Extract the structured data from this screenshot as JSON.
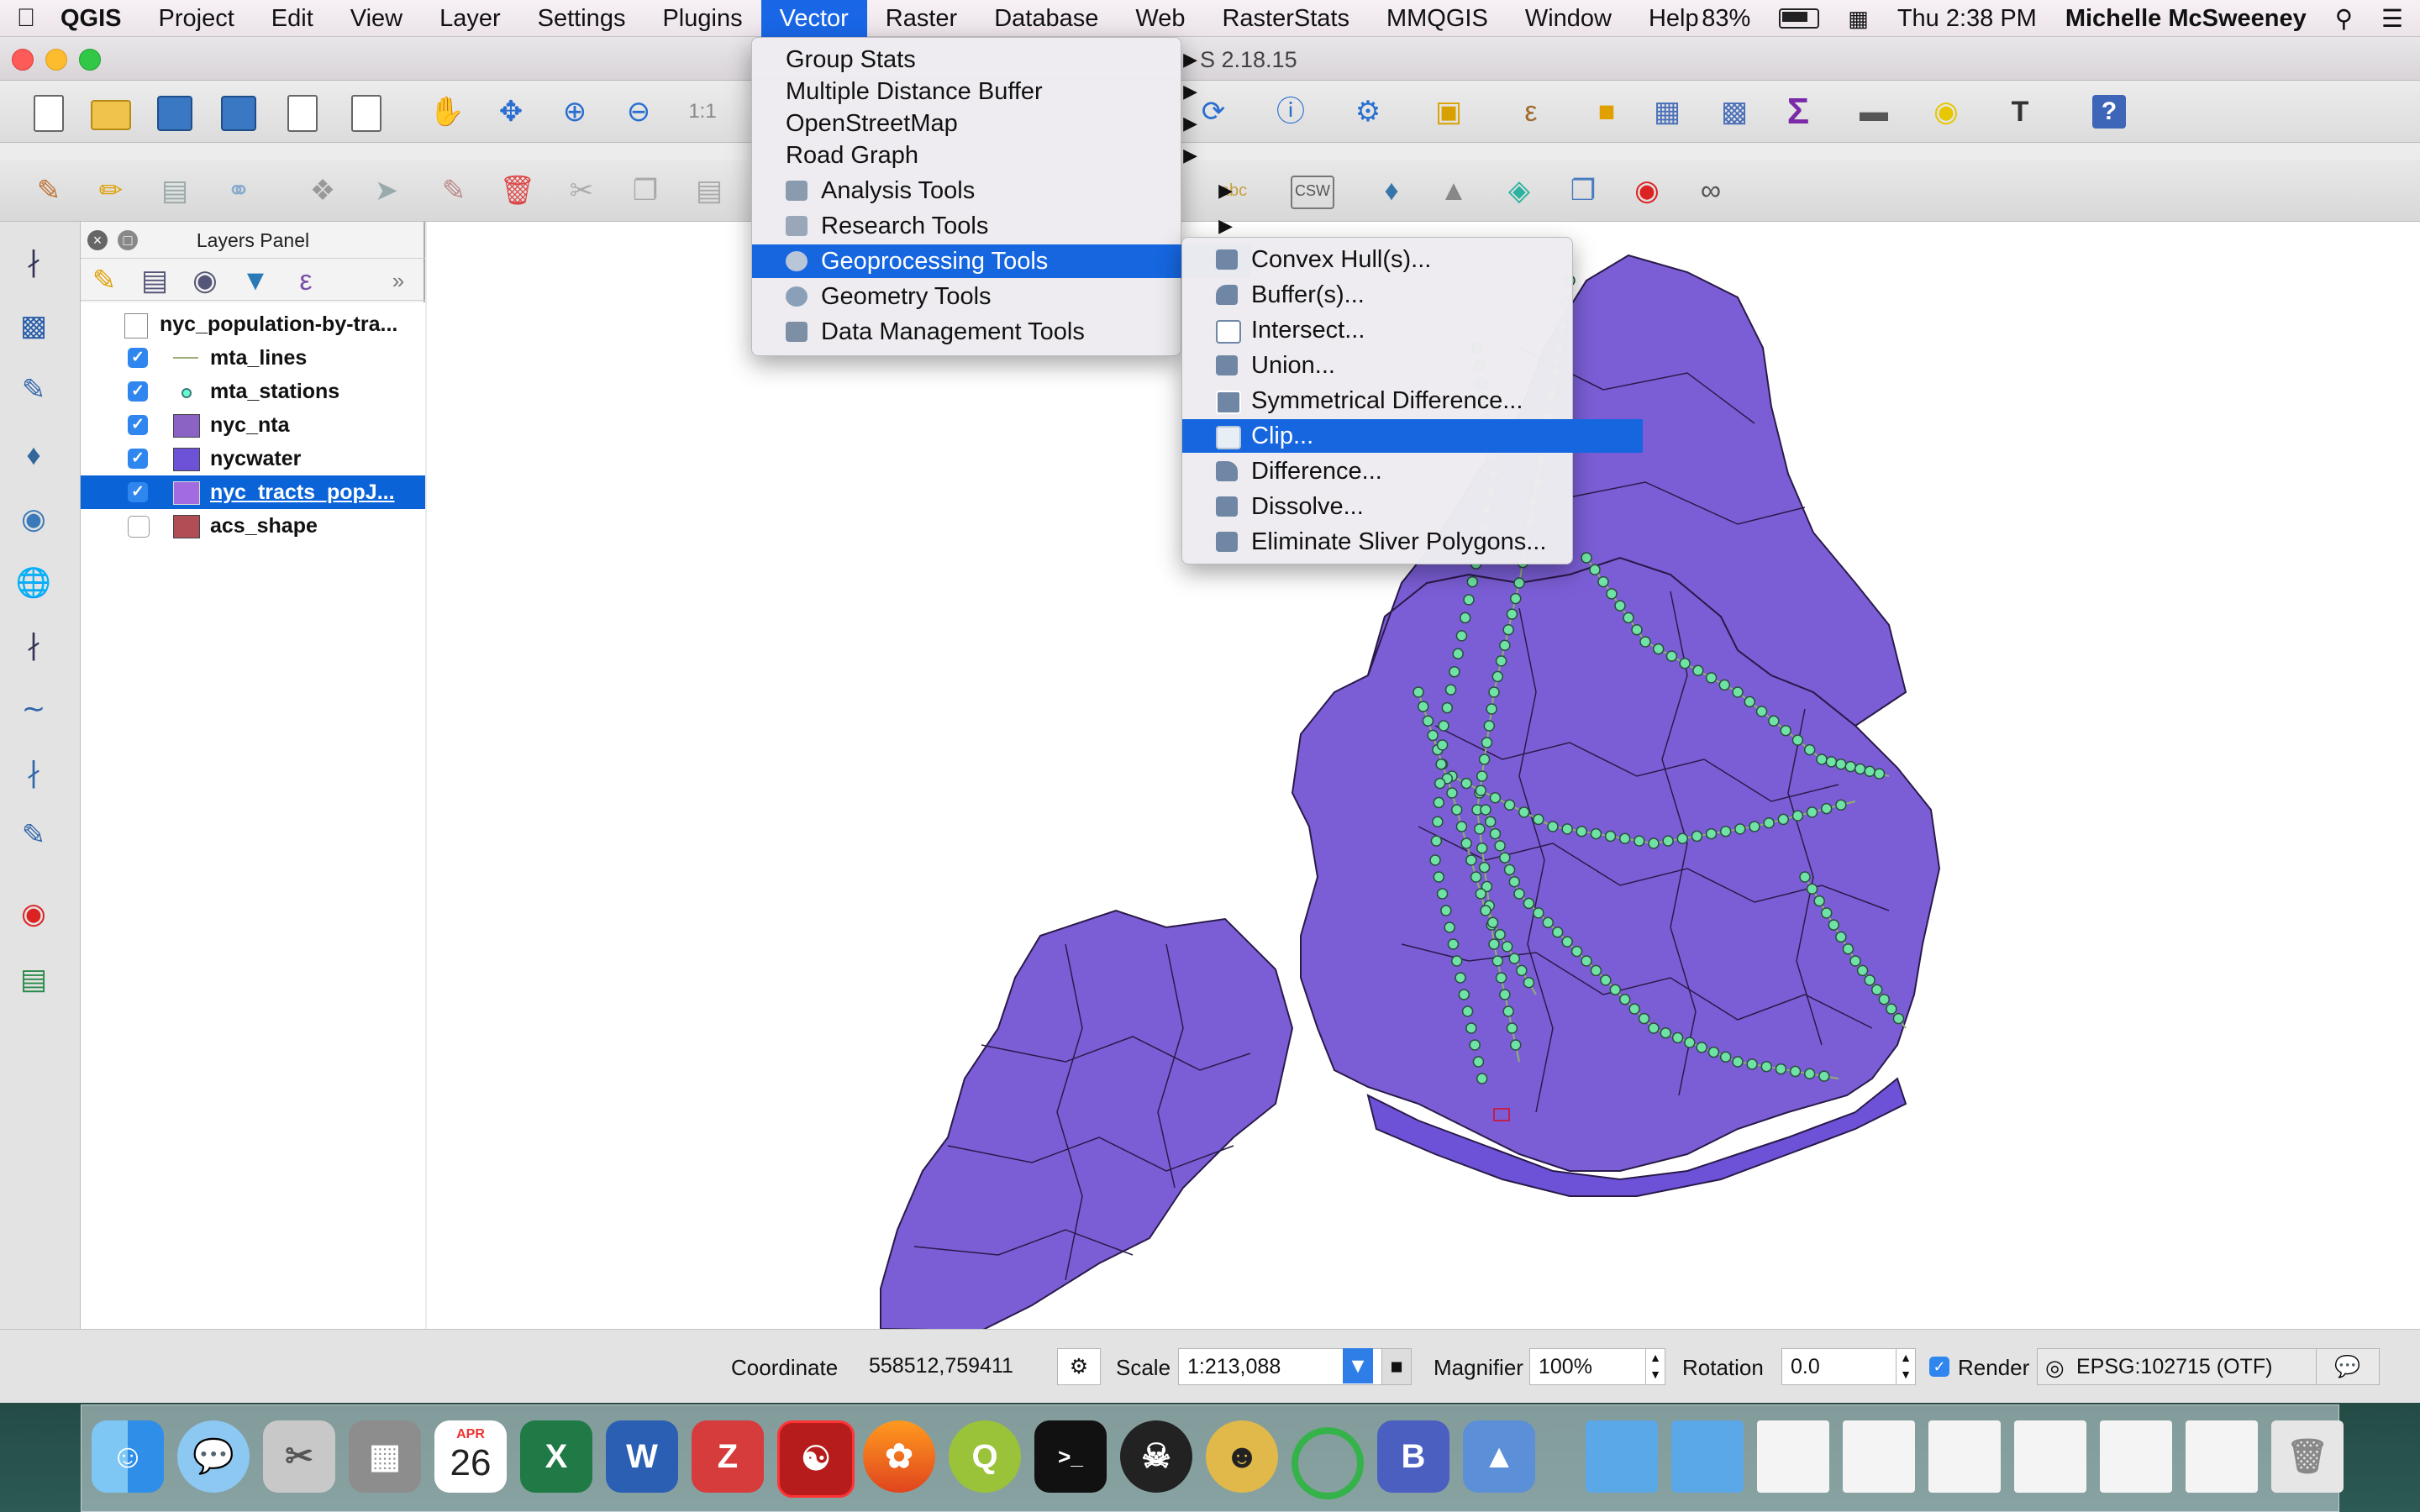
{
  "menubar": {
    "app": "QGIS",
    "items": [
      "Project",
      "Edit",
      "View",
      "Layer",
      "Settings",
      "Plugins",
      "Vector",
      "Raster",
      "Database",
      "Web",
      "RasterStats",
      "MMQGIS",
      "Window",
      "Help"
    ],
    "active": "Vector",
    "battery": "83%",
    "clock": "Thu 2:38 PM",
    "user": "Michelle McSweeney"
  },
  "window": {
    "title_fragment": "S 2.18.15"
  },
  "vector_menu": {
    "items": [
      {
        "label": "Group Stats",
        "submenu": true
      },
      {
        "label": "Multiple Distance Buffer",
        "submenu": true
      },
      {
        "label": "OpenStreetMap",
        "submenu": true
      },
      {
        "label": "Road Graph",
        "submenu": true
      },
      {
        "label": "Analysis Tools",
        "submenu": true
      },
      {
        "label": "Research Tools",
        "submenu": true
      },
      {
        "label": "Geoprocessing Tools",
        "submenu": true
      },
      {
        "label": "Geometry Tools",
        "submenu": true
      },
      {
        "label": "Data Management Tools",
        "submenu": true
      }
    ],
    "highlighted": "Geoprocessing Tools"
  },
  "geo_submenu": {
    "items": [
      "Convex Hull(s)...",
      "Buffer(s)...",
      "Intersect...",
      "Union...",
      "Symmetrical Difference...",
      "Clip...",
      "Difference...",
      "Dissolve...",
      "Eliminate Sliver Polygons..."
    ],
    "highlighted": "Clip..."
  },
  "layers_panel": {
    "title": "Layers Panel",
    "layers": [
      {
        "name": "nyc_population-by-tra...",
        "checked": null,
        "type": "table"
      },
      {
        "name": "mta_lines",
        "checked": true,
        "type": "line"
      },
      {
        "name": "mta_stations",
        "checked": true,
        "type": "point"
      },
      {
        "name": "nyc_nta",
        "checked": true,
        "type": "polygon",
        "color": "#8a63c4"
      },
      {
        "name": "nycwater",
        "checked": true,
        "type": "polygon",
        "color": "#6d52d8"
      },
      {
        "name": "nyc_tracts_popJ...",
        "checked": true,
        "type": "polygon",
        "color": "#a36be0",
        "selected": true
      },
      {
        "name": "acs_shape",
        "checked": false,
        "type": "polygon",
        "color": "#b04d55"
      }
    ]
  },
  "statusbar": {
    "coordinate_label": "Coordinate",
    "coordinate": "558512,759411",
    "scale_label": "Scale",
    "scale": "1:213,088",
    "magnifier_label": "Magnifier",
    "magnifier": "100%",
    "rotation_label": "Rotation",
    "rotation": "0.0",
    "render_label": "Render",
    "render_checked": true,
    "crs": "EPSG:102715 (OTF)"
  },
  "dock": {
    "calendar_month": "APR",
    "calendar_day": "26",
    "apps": [
      "finder",
      "messages",
      "scissors",
      "calculator",
      "calendar",
      "excel",
      "word",
      "zotero",
      "acrobat",
      "firefox",
      "qgis",
      "terminal",
      "skull",
      "photo",
      "green-circle",
      "bbedit",
      "keynote",
      "folder",
      "folder",
      "doc",
      "doc",
      "doc",
      "doc",
      "doc",
      "doc",
      "doc",
      "trash"
    ]
  },
  "colors": {
    "menu_highlight": "#1666e0",
    "map_fill": "#7b5ed6",
    "map_outline": "#2a1a4a",
    "station_point": "#6fe3a5"
  }
}
